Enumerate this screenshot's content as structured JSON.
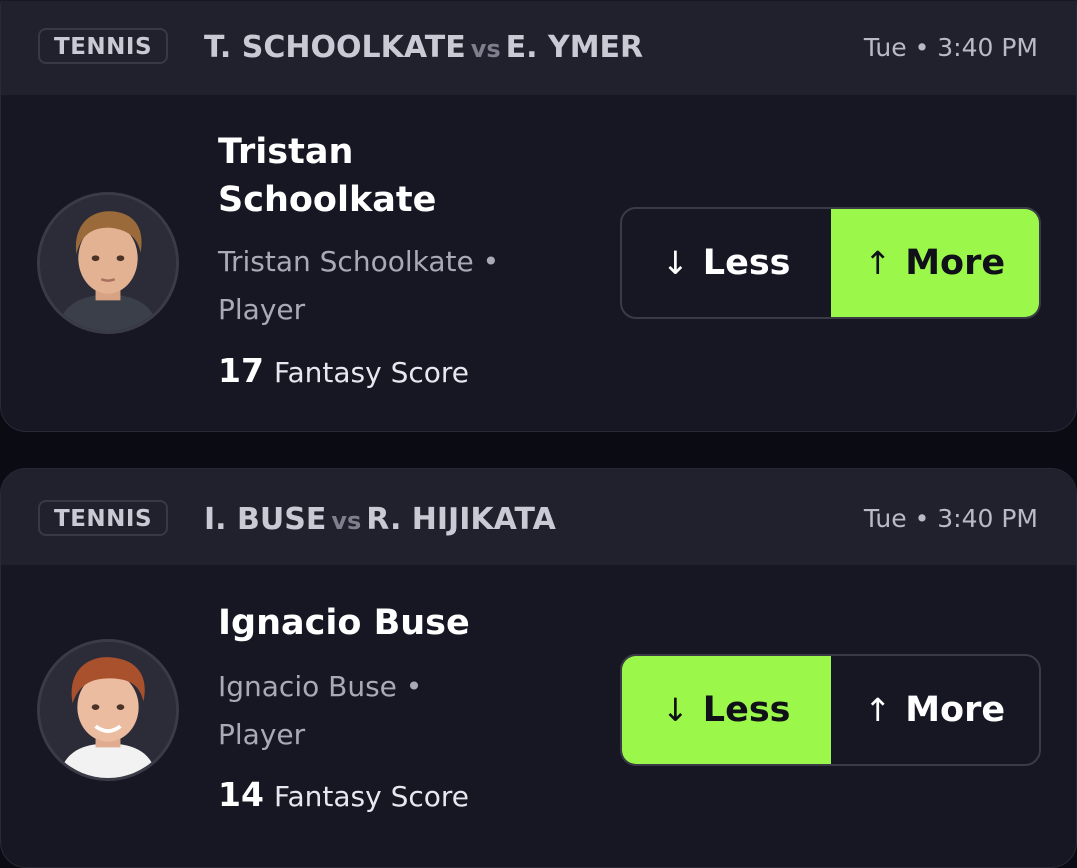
{
  "colors": {
    "background": "#0b0b14",
    "card": "#171723",
    "card_header": "#21212d",
    "accent_selected": "#9bf84b"
  },
  "icons": {
    "arrow_down": "↓",
    "arrow_up": "↑"
  },
  "cards": [
    {
      "sport": "TENNIS",
      "player1": "T. SCHOOLKATE",
      "vs": "vs",
      "player2": "E. YMER",
      "time": "Tue • 3:40 PM",
      "name": "Tristan Schoolkate",
      "subtitle": "Tristan Schoolkate • Player",
      "score": "17",
      "score_label": "Fantasy Score",
      "less_label": "Less",
      "more_label": "More",
      "selected": "more"
    },
    {
      "sport": "TENNIS",
      "player1": "I. BUSE",
      "vs": "vs",
      "player2": "R. HIJIKATA",
      "time": "Tue • 3:40 PM",
      "name": "Ignacio Buse",
      "subtitle": "Ignacio Buse • Player",
      "score": "14",
      "score_label": "Fantasy Score",
      "less_label": "Less",
      "more_label": "More",
      "selected": "less"
    }
  ]
}
